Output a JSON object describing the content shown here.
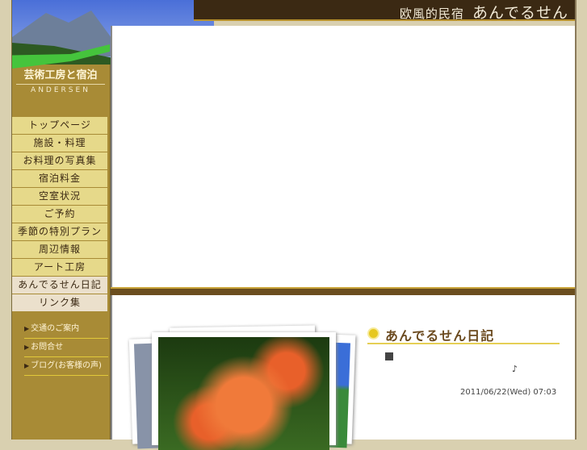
{
  "header": {
    "subtitle": "欧風的民宿",
    "title": "あんでるせん"
  },
  "brand": {
    "line1": "芸術工房と宿泊",
    "line2": "ANDERSEN"
  },
  "nav": [
    "トップページ",
    "施設・料理",
    "お料理の写真集",
    "宿泊料金",
    "空室状況",
    "ご予約",
    "季節の特別プラン",
    "周辺情報",
    "アート工房",
    "あんでるせん日記",
    "リンク集"
  ],
  "links": [
    "交通のご案内",
    "お問合せ",
    "ブログ(お客様の声)"
  ],
  "diary": {
    "title": "あんでるせん日記",
    "note": "♪",
    "date": "2011/06/22(Wed) 07:03"
  }
}
